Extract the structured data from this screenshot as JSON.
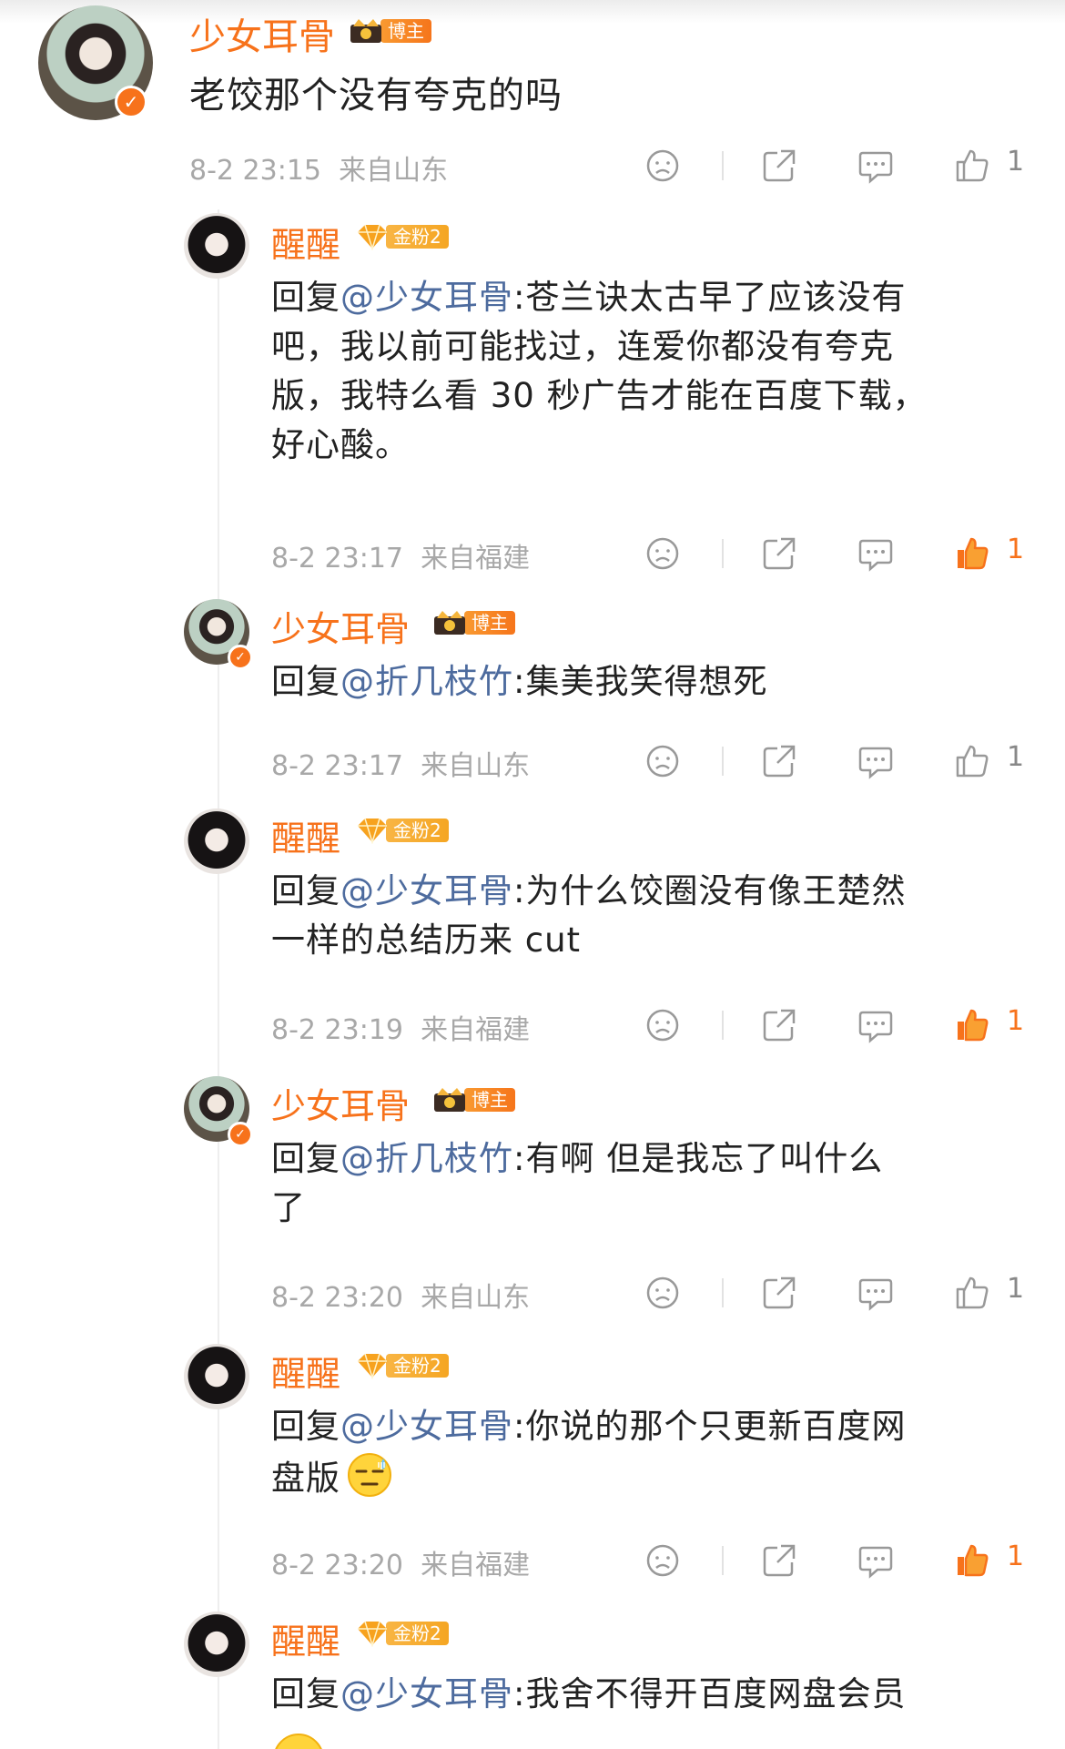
{
  "accent_color": "#f7721b",
  "mention_color": "#4d6b9e",
  "comments": [
    {
      "name": "少女耳骨",
      "badge": "博主",
      "verified": true,
      "text": "老饺那个没有夸克的吗",
      "time": "8-2 23:15",
      "location": "来自山东",
      "likes": "1",
      "liked": false
    },
    {
      "name": "醒醒",
      "badge": "金粉2",
      "reply_prefix": "回复",
      "mention": "@少女耳骨",
      "body_lines": [
        ":苍兰诀太古早了应该没有",
        "吧，我以前可能找过，连爱你都没有夸克",
        "版，我特么看 30 秒广告才能在百度下载，",
        "好心酸。"
      ],
      "time": "8-2 23:17",
      "location": "来自福建",
      "likes": "1",
      "liked": true
    },
    {
      "name": "少女耳骨",
      "badge": "博主",
      "verified": true,
      "reply_prefix": "回复",
      "mention": "@折几枝竹",
      "body_lines": [
        ":集美我笑得想死"
      ],
      "time": "8-2 23:17",
      "location": "来自山东",
      "likes": "1",
      "liked": false
    },
    {
      "name": "醒醒",
      "badge": "金粉2",
      "reply_prefix": "回复",
      "mention": "@少女耳骨",
      "body_lines": [
        ":为什么饺圈没有像王楚然",
        "一样的总结历来 cut"
      ],
      "time": "8-2 23:19",
      "location": "来自福建",
      "likes": "1",
      "liked": true
    },
    {
      "name": "少女耳骨",
      "badge": "博主",
      "verified": true,
      "reply_prefix": "回复",
      "mention": "@折几枝竹",
      "body_lines": [
        ":有啊 但是我忘了叫什么",
        "了"
      ],
      "time": "8-2 23:20",
      "location": "来自山东",
      "likes": "1",
      "liked": false
    },
    {
      "name": "醒醒",
      "badge": "金粉2",
      "reply_prefix": "回复",
      "mention": "@少女耳骨",
      "body_lines": [
        ":你说的那个只更新百度网",
        "盘版"
      ],
      "emoji": "sweat-emoji",
      "time": "8-2 23:20",
      "location": "来自福建",
      "likes": "1",
      "liked": true
    },
    {
      "name": "醒醒",
      "badge": "金粉2",
      "reply_prefix": "回复",
      "mention": "@少女耳骨",
      "body_lines": [
        ":我舍不得开百度网盘会员"
      ]
    }
  ]
}
